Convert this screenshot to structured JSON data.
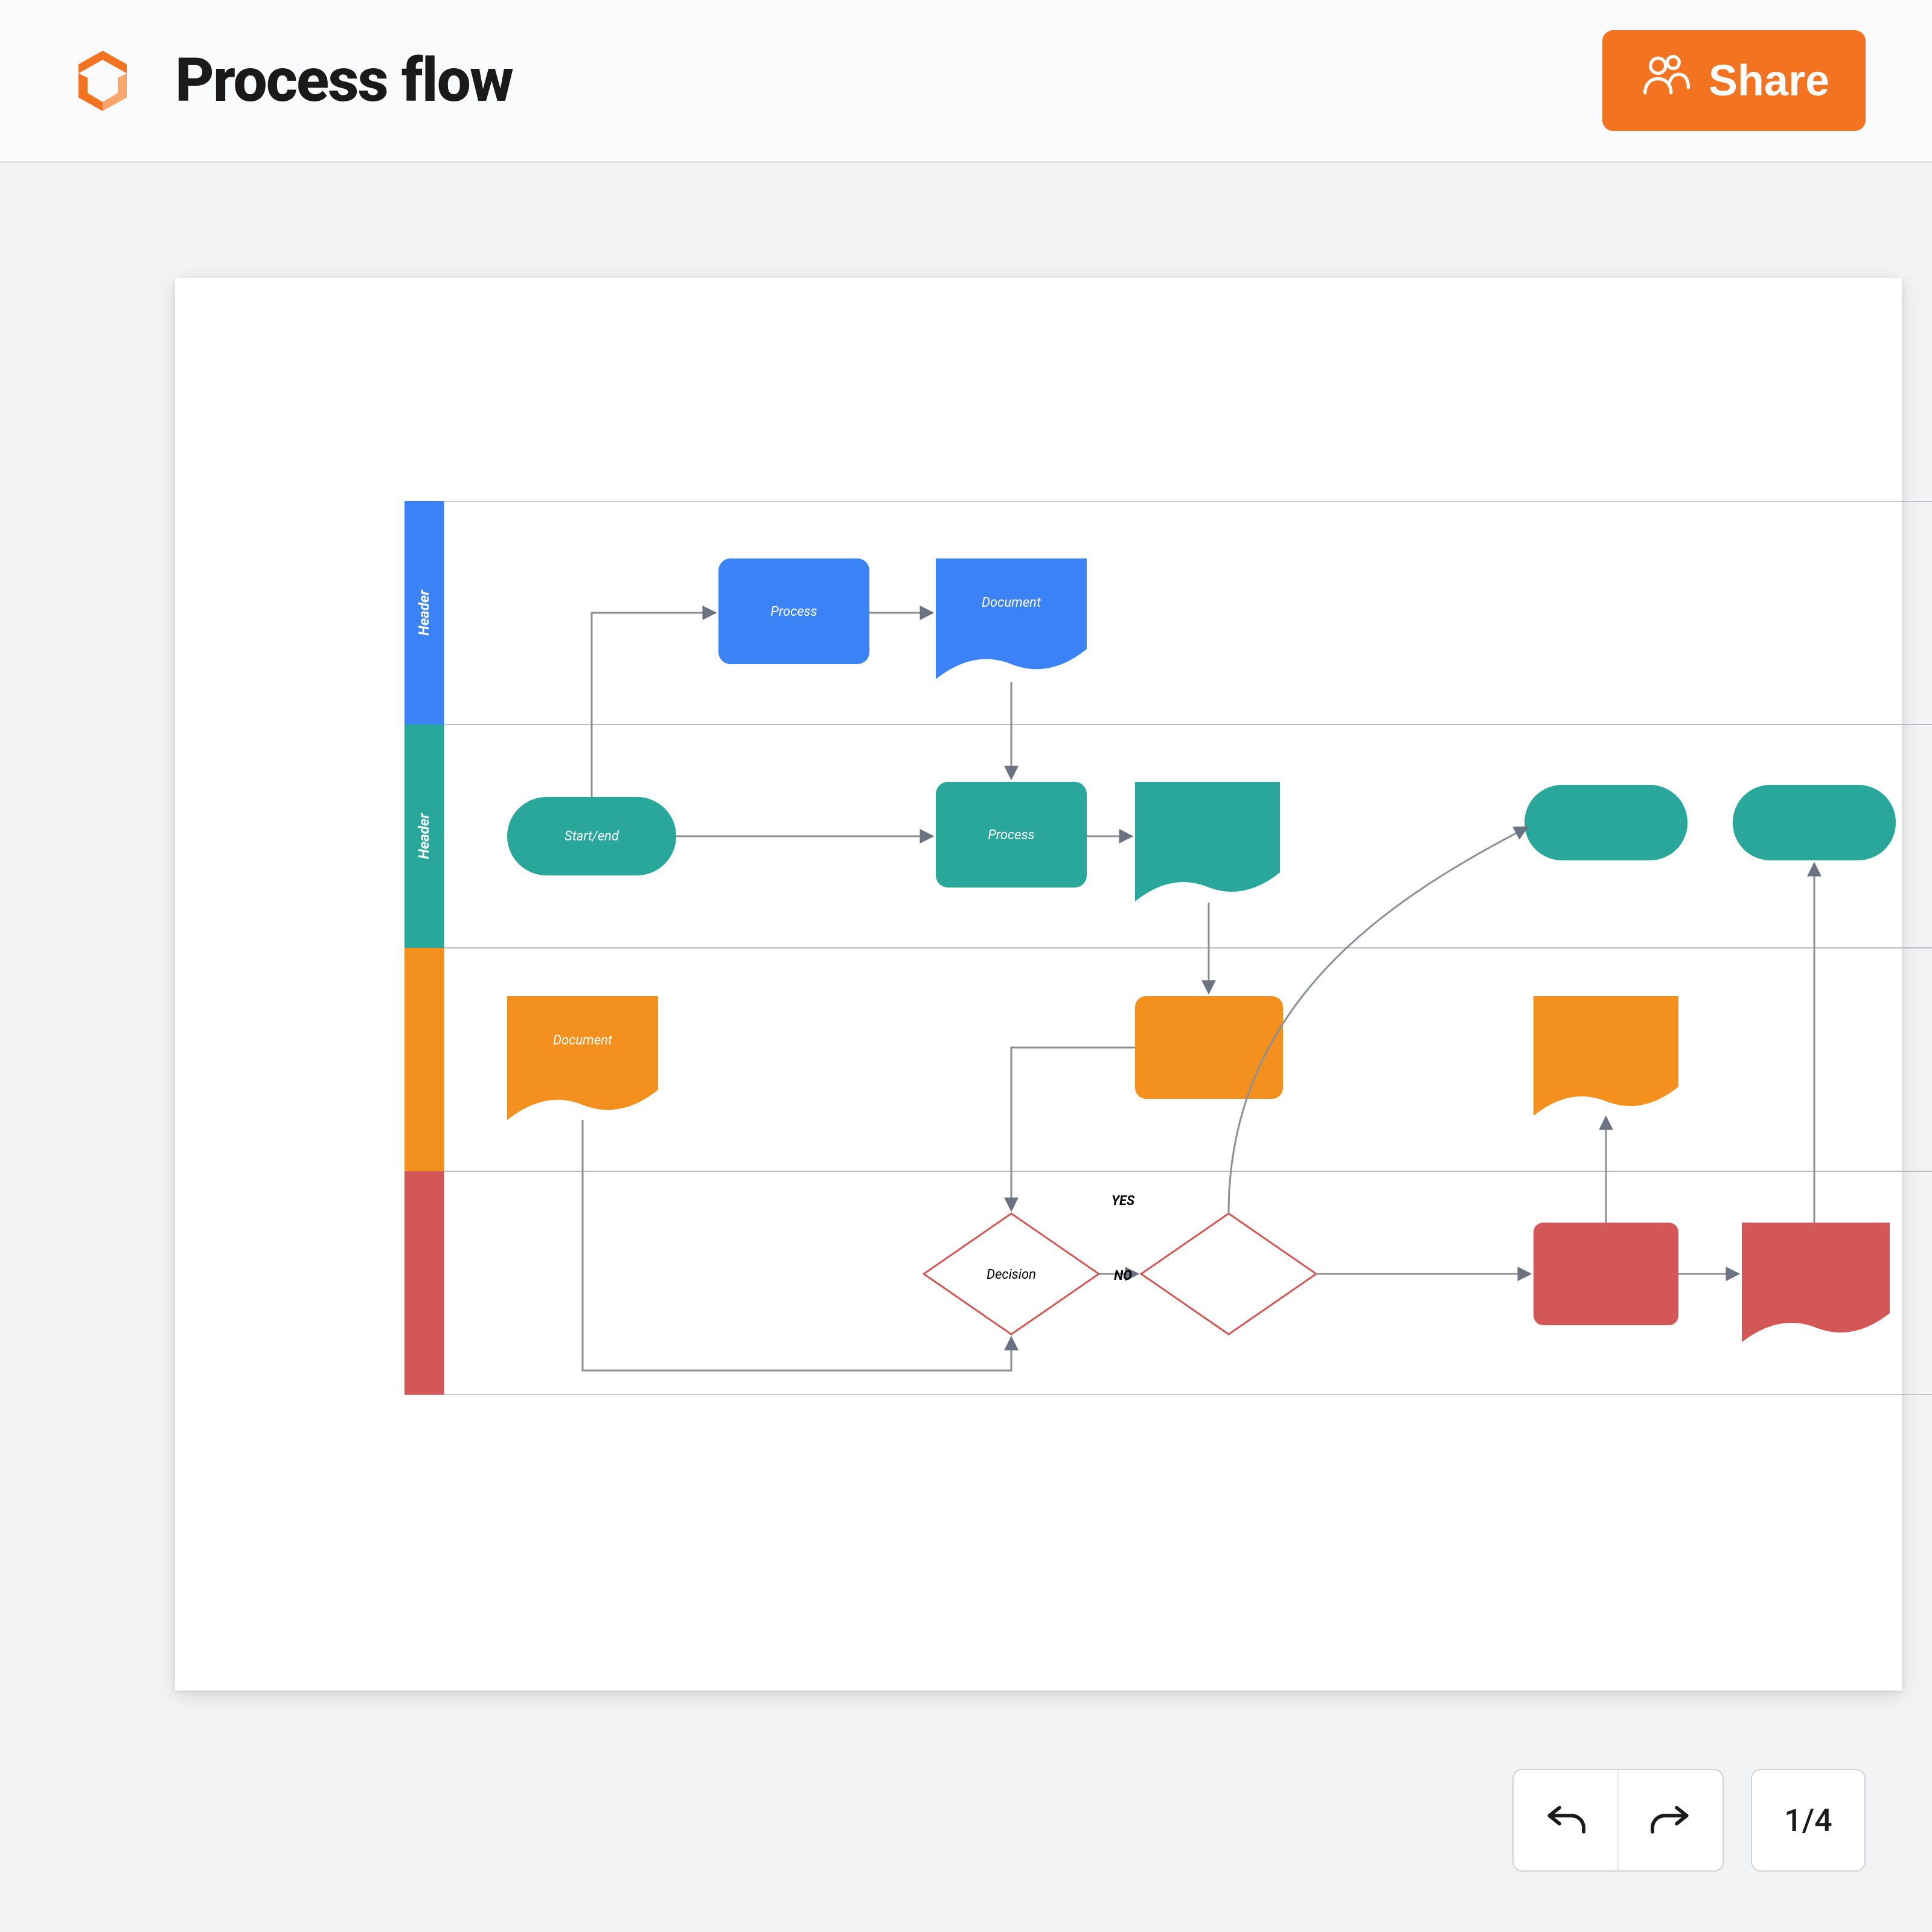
{
  "header": {
    "title": "Process flow",
    "share_label": "Share"
  },
  "toolbar": {
    "page_indicator": "1/4"
  },
  "diagram": {
    "lanes": [
      {
        "label": "Header",
        "color": "#3b82f6"
      },
      {
        "label": "Header",
        "color": "#2aa79b"
      },
      {
        "label": "",
        "color": "#f4901e"
      },
      {
        "label": "",
        "color": "#d45757"
      }
    ],
    "nodes": {
      "process_blue": "Process",
      "document_blue": "Document",
      "start_end": "Start/end",
      "process_teal": "Process",
      "document_orange": "Document",
      "decision": "Decision"
    },
    "edges": {
      "yes": "YES",
      "no": "NO"
    }
  }
}
